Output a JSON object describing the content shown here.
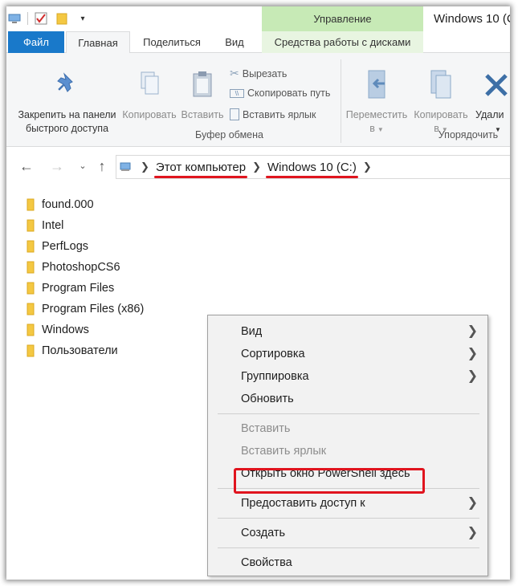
{
  "window": {
    "title": "Windows 10 (C",
    "context_tab_label": "Управление"
  },
  "tabs": {
    "file": "Файл",
    "home": "Главная",
    "share": "Поделиться",
    "view": "Вид",
    "disk_tools": "Средства работы с дисками"
  },
  "ribbon": {
    "pin_line1": "Закрепить на панели",
    "pin_line2": "быстрого доступа",
    "copy": "Копировать",
    "paste": "Вставить",
    "cut": "Вырезать",
    "copy_path": "Скопировать путь",
    "paste_shortcut": "Вставить ярлык",
    "clipboard_group": "Буфер обмена",
    "move_line1": "Переместить",
    "move_line2": "в",
    "copyto_line1": "Копировать",
    "copyto_line2": "в",
    "delete": "Удали",
    "organize_group": "Упорядочить"
  },
  "address": {
    "crumbs": [
      "Этот компьютер",
      "Windows 10 (C:)"
    ]
  },
  "files": [
    "found.000",
    "Intel",
    "PerfLogs",
    "PhotoshopCS6",
    "Program Files",
    "Program Files (x86)",
    "Windows",
    "Пользователи"
  ],
  "context_menu": {
    "view": "Вид",
    "sort": "Сортировка",
    "group": "Группировка",
    "refresh": "Обновить",
    "paste": "Вставить",
    "paste_shortcut": "Вставить ярлык",
    "powershell": "Открыть окно PowerShell здесь",
    "share": "Предоставить доступ к",
    "create": "Создать",
    "properties": "Свойства"
  },
  "colors": {
    "accent_file_tab": "#1979ca",
    "manage_tab": "#c7eab6",
    "annotation_red": "#e0141e"
  }
}
